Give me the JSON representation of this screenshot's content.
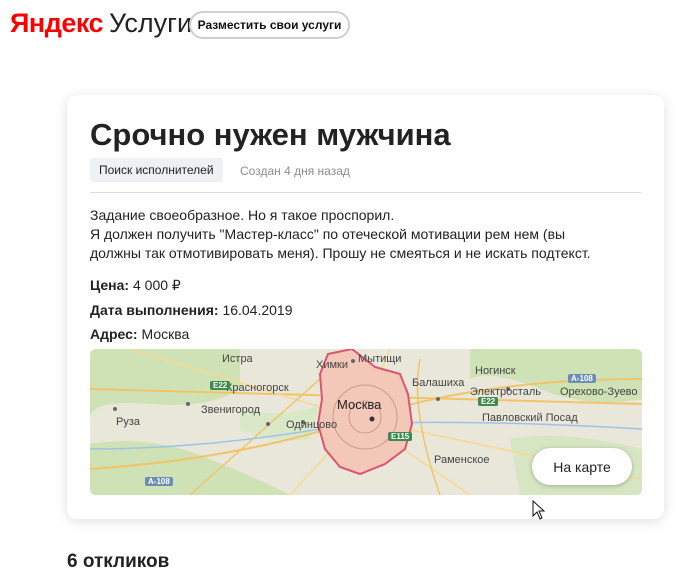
{
  "header": {
    "brand_yandex": "Яндекс",
    "brand_services": "Услуги",
    "post_button": "Разместить свои услуги"
  },
  "task": {
    "title": "Срочно нужен мужчина",
    "tag": "Поиск исполнителей",
    "created": "Создан 4 дня назад",
    "description_lines": [
      "Задание своеобразное. Но я такое проспорил.",
      "Я должен получить \"Мастер-класс\" по отеческой мотивации рем нем (вы",
      "должны так отмотивировать меня). Прошу не смеяться и не искать подтекст."
    ],
    "price_label": "Цена:",
    "price_value": "4 000 ₽",
    "date_label": "Дата выполнения:",
    "date_value": "16.04.2019",
    "address_label": "Адрес:",
    "address_value": "Москва"
  },
  "map": {
    "button": "На карте",
    "labels": {
      "istra": "Истра",
      "khimki": "Химки",
      "mytishchi": "Мытищи",
      "noginsk": "Ногинск",
      "krasnogorsk": "Красногорск",
      "balashikha": "Балашиха",
      "elektrostal": "Электросталь",
      "orekhovo": "Орехово-Зуево",
      "moskva": "Москва",
      "zvenigorod": "Звенигород",
      "odintsovo": "Одинцово",
      "ruza": "Руза",
      "pavlovsky": "Павловский Посад",
      "ramenskoye": "Раменское"
    },
    "roads": {
      "e22_left": "E22",
      "e22_right": "E22",
      "a108_top": "A-108",
      "a108_bottom": "A-108",
      "e115": "E115"
    }
  },
  "responses": "6 откликов",
  "colors": {
    "brand_red": "#ff0000",
    "city_fill": "#f4c8b8",
    "city_border": "#e0536e"
  }
}
